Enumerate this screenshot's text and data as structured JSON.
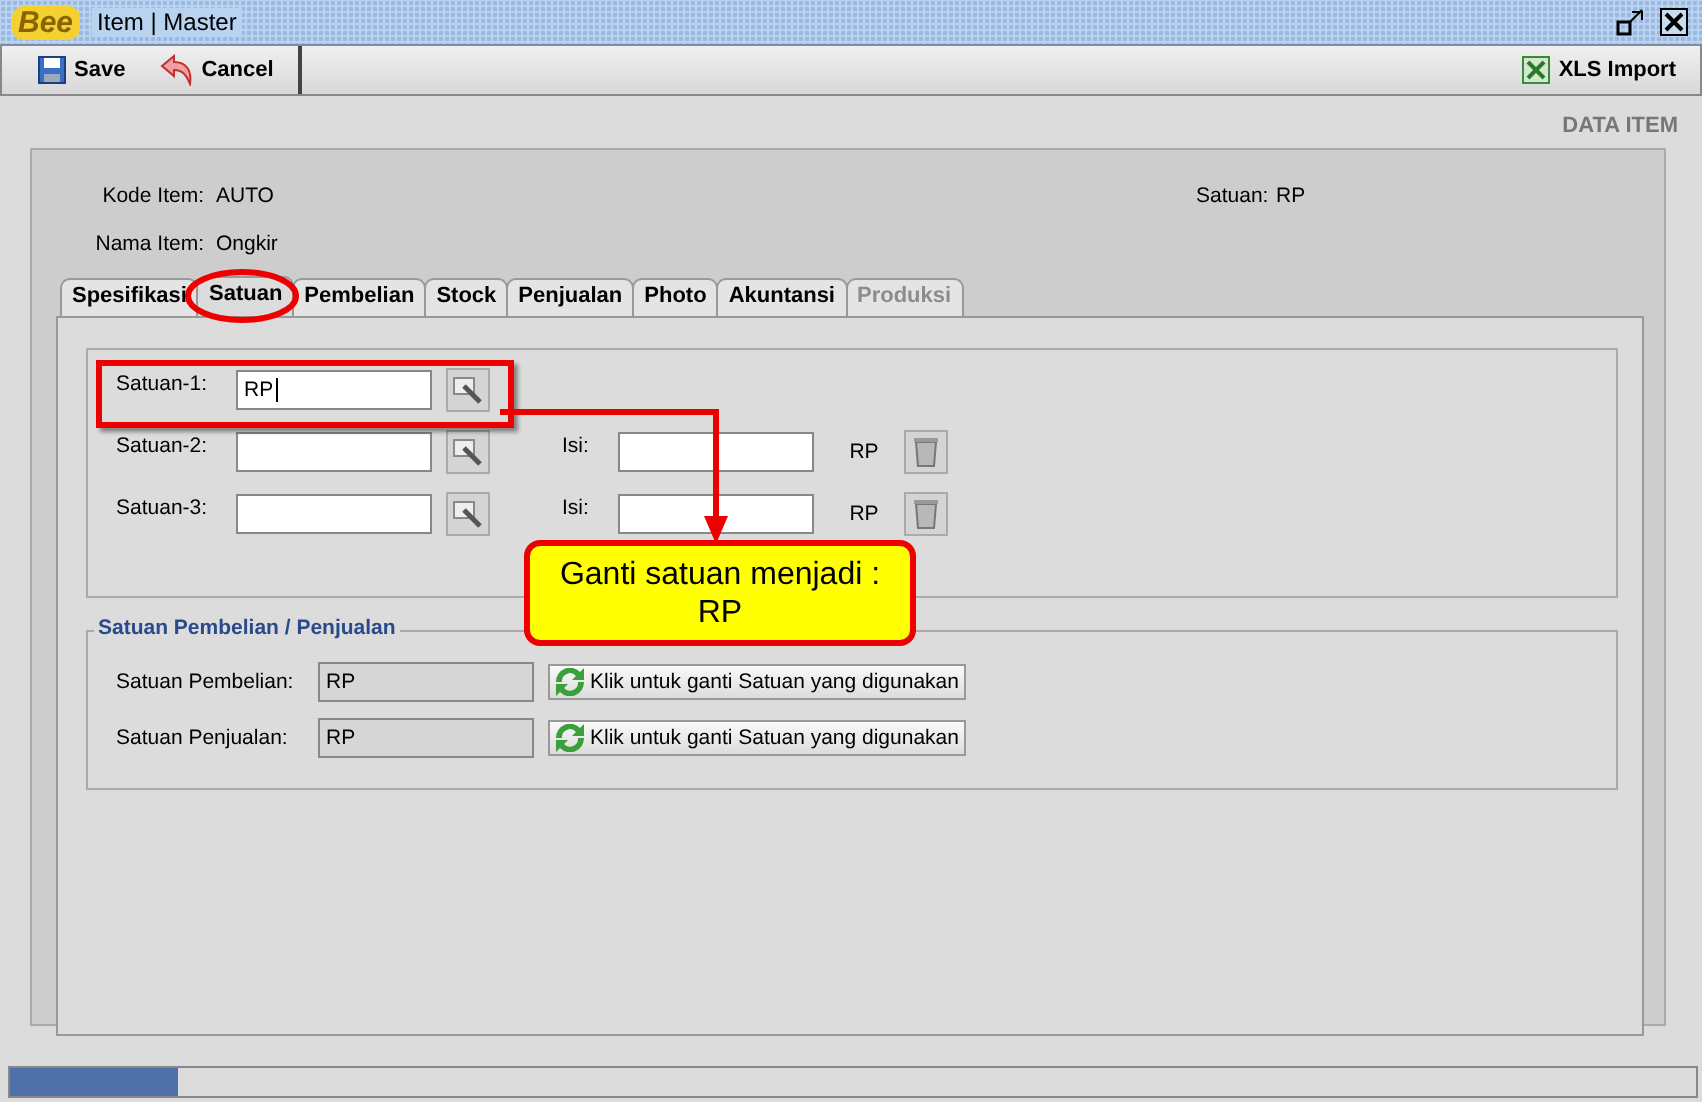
{
  "window": {
    "app_logo": "Bee",
    "title": "Item | Master"
  },
  "toolbar": {
    "buttons": [
      {
        "label": "Save",
        "kind": "save"
      },
      {
        "label": "Cancel",
        "kind": "cancel"
      }
    ],
    "import_button": "XLS Import"
  },
  "section_title": "DATA ITEM",
  "header": {
    "kode_label": "Kode Item:",
    "kode_value": "AUTO",
    "nama_label": "Nama Item:",
    "nama_value": "Ongkir",
    "satuan_label": "Satuan:",
    "satuan_value": "RP"
  },
  "tabs": [
    {
      "label": "Spesifikasi",
      "selected": false,
      "disabled": false
    },
    {
      "label": "Satuan",
      "selected": true,
      "disabled": false
    },
    {
      "label": "Pembelian",
      "selected": false,
      "disabled": false
    },
    {
      "label": "Stock",
      "selected": false,
      "disabled": false
    },
    {
      "label": "Penjualan",
      "selected": false,
      "disabled": false
    },
    {
      "label": "Photo",
      "selected": false,
      "disabled": false
    },
    {
      "label": "Akuntansi",
      "selected": false,
      "disabled": false
    },
    {
      "label": "Produksi",
      "selected": false,
      "disabled": true
    }
  ],
  "units": [
    {
      "kind": "base",
      "label": "Satuan-1:",
      "value": "RP"
    },
    {
      "kind": "conversion",
      "label": "Satuan-2:",
      "isi_label": "Isi:",
      "unit": "RP"
    },
    {
      "kind": "conversion",
      "label": "Satuan-3:",
      "isi_label": "Isi:",
      "unit": "RP"
    }
  ],
  "trade_group": {
    "title": "Satuan Pembelian / Penjualan",
    "rows": [
      {
        "label": "Satuan Pembelian:",
        "value": "RP",
        "button": "Klik untuk ganti Satuan yang digunakan"
      },
      {
        "label": "Satuan Penjualan:",
        "value": "RP",
        "button": "Klik untuk ganti Satuan yang digunakan"
      }
    ]
  },
  "callout": {
    "line1": "Ganti satuan menjadi :",
    "line2": "RP"
  },
  "status_bar": {
    "level": 0.1
  }
}
